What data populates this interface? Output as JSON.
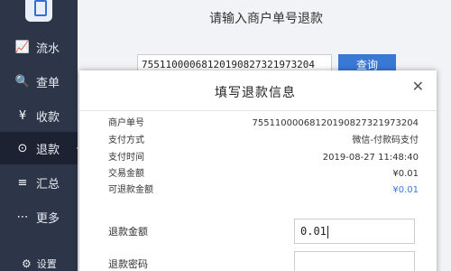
{
  "sidebar": {
    "items": [
      {
        "icon": "📈",
        "icon_name": "chart-icon",
        "label": "流水"
      },
      {
        "icon": "🔍",
        "icon_name": "search-doc-icon",
        "label": "查单"
      },
      {
        "icon": "¥",
        "icon_name": "yen-icon",
        "label": "收款"
      },
      {
        "icon": "⊙",
        "icon_name": "refund-icon",
        "label": "退款"
      },
      {
        "icon": "≡",
        "icon_name": "summary-icon",
        "label": "汇总"
      },
      {
        "icon": "⋯",
        "icon_name": "more-icon",
        "label": "更多"
      }
    ],
    "active_index": 3,
    "settings": {
      "icon": "⚙",
      "label": "设置"
    }
  },
  "header": {
    "title": "请输入商户单号退款",
    "order_input_value": "7551100006812019082732197320­4",
    "query_label": "查询"
  },
  "modal": {
    "title": "填写退款信息",
    "close": "✕",
    "rows": [
      {
        "label": "商户单号",
        "value": "75511000068120190827321973204"
      },
      {
        "label": "支付方式",
        "value": "微信-付款码支付"
      },
      {
        "label": "支付时间",
        "value": "2019-08-27 11:48:40"
      },
      {
        "label": "交易金额",
        "value": "¥0.01"
      },
      {
        "label": "可退款金额",
        "value": "¥0.01"
      }
    ],
    "amount_label": "退款金额",
    "amount_value": "0.01",
    "password_label": "退款密码"
  },
  "colors": {
    "sidebar_bg": "#2d3548",
    "accent": "#3a78d6"
  }
}
